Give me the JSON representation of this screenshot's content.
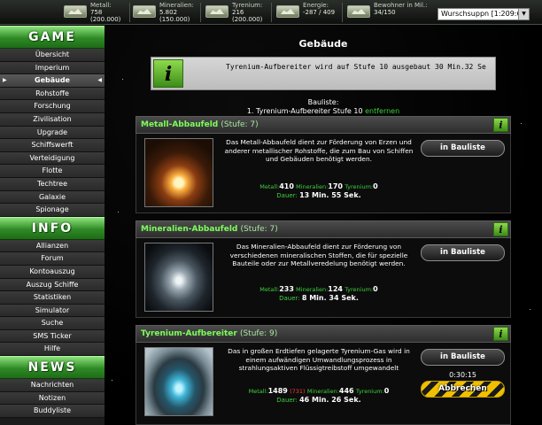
{
  "topbar": {
    "resources": [
      {
        "label": "Metall:",
        "value": "758",
        "cap": "(200.000)",
        "icon": "metal-icon"
      },
      {
        "label": "Mineralien:",
        "value": "5.802",
        "cap": "(150.000)",
        "icon": "minerals-icon"
      },
      {
        "label": "Tyrenium:",
        "value": "216",
        "cap": "(200.000)",
        "icon": "tyrenium-icon"
      },
      {
        "label": "Energie:",
        "value": "-287 / 409",
        "cap": "",
        "icon": "energy-icon"
      },
      {
        "label": "Bewohner in Mil.:",
        "value": "34/150",
        "cap": "",
        "icon": "population-icon"
      }
    ],
    "planet_select": "Wurschsuppn [1:209:6]"
  },
  "sidebar": {
    "game": {
      "title": "GAME",
      "items": [
        "Übersicht",
        "Imperium",
        "Gebäude",
        "Rohstoffe",
        "Forschung",
        "Zivilisation",
        "Upgrade",
        "Schiffswerft",
        "Verteidigung",
        "Flotte",
        "Techtree",
        "Galaxie",
        "Spionage"
      ],
      "active": "Gebäude"
    },
    "info": {
      "title": "INFO",
      "items": [
        "Allianzen",
        "Forum",
        "Kontoauszug",
        "Auszug Schiffe",
        "Statistiken",
        "Simulator",
        "Suche",
        "SMS Ticker",
        "Hilfe"
      ]
    },
    "news": {
      "title": "NEWS",
      "items": [
        "Nachrichten",
        "Notizen",
        "Buddyliste"
      ]
    }
  },
  "main": {
    "title": "Gebäude",
    "info_message": "Tyrenium-Aufbereiter wird auf Stufe 10 ausgebaut 30 Min.32 Se",
    "bauliste_title": "Bauliste:",
    "bauliste_entry": "1. Tyrenium-Aufbereiter Stufe 10",
    "bauliste_remove": "entfernen",
    "buildings": [
      {
        "name": "Metall-Abbaufeld",
        "level": "(Stufe: 7)",
        "description": "Das Metall-Abbaufeld dient zur Förderung von Erzen und anderer metallischer Rohstoffe, die zum Bau von Schiffen und Gebäuden benötigt werden.",
        "cost_metal": "410",
        "cost_minerals": "170",
        "cost_tyrenium": "0",
        "duration": "13 Min. 55 Sek.",
        "button": "in Bauliste"
      },
      {
        "name": "Mineralien-Abbaufeld",
        "level": "(Stufe: 7)",
        "description": "Das Mineralien-Abbaufeld dient zur Förderung von verschiedenen mineralischen Stoffen, die für spezielle Bauteile oder zur Metallveredelung benötigt werden.",
        "cost_metal": "233",
        "cost_minerals": "124",
        "cost_tyrenium": "0",
        "duration": "8 Min. 34 Sek.",
        "button": "in Bauliste"
      },
      {
        "name": "Tyrenium-Aufbereiter",
        "level": "(Stufe: 9)",
        "description": "Das in großen Erdtiefen gelagerte Tyrenium-Gas wird in einem aufwändigen Umwandlungsprozess in strahlungsaktiven Flüssigtreibstoff umgewandelt",
        "cost_metal": "1489",
        "cost_metal_missing": "(731)",
        "cost_minerals": "446",
        "cost_tyrenium": "0",
        "duration": "46 Min. 26 Sek.",
        "button": "in Bauliste",
        "timer": "0:30:15",
        "cancel": "Abbrechen"
      }
    ],
    "labels": {
      "metal": "Metall:",
      "minerals": "Mineralien:",
      "tyrenium": "Tyrenium:",
      "duration": "Dauer:"
    }
  },
  "colors": {
    "accent_green": "#7dff5a",
    "header_green": "#2e8a25",
    "cost_label": "#3fd13f",
    "missing_red": "#ff3d3d"
  }
}
